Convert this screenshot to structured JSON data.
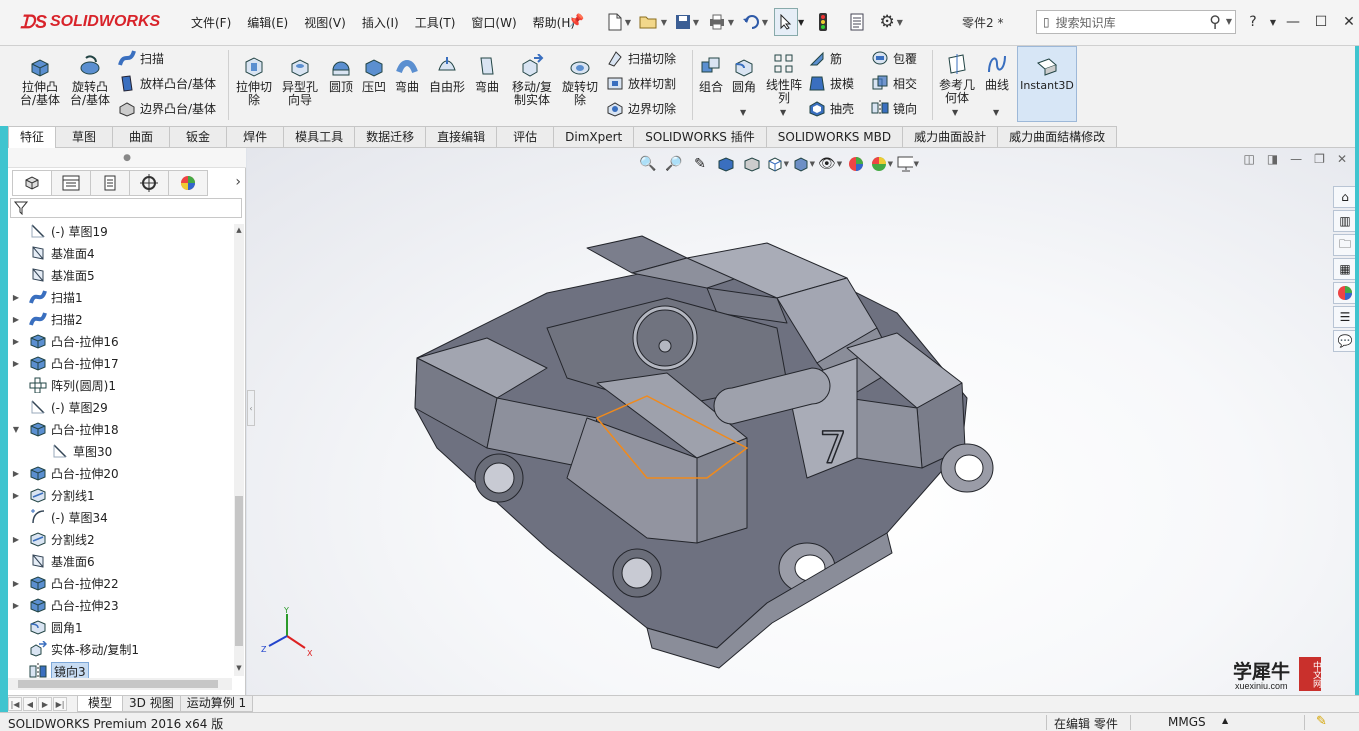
{
  "app": {
    "logo_text": "SOLIDWORKS",
    "document_name": "零件2 *",
    "colors": {
      "brand_red": "#d8232a",
      "accent_blue": "#3a6fbf",
      "selection": "#c7dcf3",
      "model_gray": "#8d9099",
      "frame_cyan": "#3fc4cf"
    }
  },
  "menu": [
    "文件(F)",
    "编辑(E)",
    "视图(V)",
    "插入(I)",
    "工具(T)",
    "窗口(W)",
    "帮助(H)"
  ],
  "search": {
    "placeholder": "搜索知识库"
  },
  "ribbon": {
    "extrude_boss": "拉伸凸\n台/基体",
    "revolve_boss": "旋转凸\n台/基体",
    "sweep": "扫描",
    "loft_boss": "放样凸台/基体",
    "boundary_boss": "边界凸台/基体",
    "extrude_cut": "拉伸切\n除",
    "hole_wizard": "异型孔\n向导",
    "dome": "圆顶",
    "indent": "压凹",
    "flex": "弯曲",
    "freeform": "自由形",
    "deform": "弯曲",
    "move_copy": "移动/复\n制实体",
    "revolve_cut": "旋转切\n除",
    "swept_cut": "扫描切除",
    "lofted_cut": "放样切割",
    "boundary_cut": "边界切除",
    "combine": "组合",
    "fillet": "圆角",
    "linear_pattern": "线性阵\n列",
    "rib": "筋",
    "draft": "拔模",
    "shell": "抽壳",
    "wrap": "包覆",
    "intersect": "相交",
    "mirror": "镜向",
    "ref_geometry": "参考几\n何体",
    "curves": "曲线",
    "instant3d": "Instant3D"
  },
  "tabs": [
    "特征",
    "草图",
    "曲面",
    "钣金",
    "焊件",
    "模具工具",
    "数据迁移",
    "直接编辑",
    "评估",
    "DimXpert",
    "SOLIDWORKS 插件",
    "SOLIDWORKS MBD",
    "威力曲面設計",
    "威力曲面結構修改"
  ],
  "tree": [
    {
      "label": "(-) 草图19",
      "icon": "sketch-icon",
      "expand": ""
    },
    {
      "label": "基准面4",
      "icon": "plane-icon",
      "expand": ""
    },
    {
      "label": "基准面5",
      "icon": "plane-icon",
      "expand": ""
    },
    {
      "label": "扫描1",
      "icon": "sweep-icon",
      "expand": "▶"
    },
    {
      "label": "扫描2",
      "icon": "sweep-icon",
      "expand": "▶"
    },
    {
      "label": "凸台-拉伸16",
      "icon": "extrude-icon",
      "expand": "▶"
    },
    {
      "label": "凸台-拉伸17",
      "icon": "extrude-icon",
      "expand": "▶"
    },
    {
      "label": "阵列(圆周)1",
      "icon": "pattern-icon",
      "expand": ""
    },
    {
      "label": "(-) 草图29",
      "icon": "sketch-icon",
      "expand": ""
    },
    {
      "label": "凸台-拉伸18",
      "icon": "extrude-icon",
      "expand": "▼"
    },
    {
      "label": "草图30",
      "icon": "sketch-icon",
      "expand": "",
      "indent": true
    },
    {
      "label": "凸台-拉伸20",
      "icon": "extrude-icon",
      "expand": "▶"
    },
    {
      "label": "分割线1",
      "icon": "split-icon",
      "expand": "▶"
    },
    {
      "label": "(-) 草图34",
      "icon": "sketch3d-icon",
      "expand": ""
    },
    {
      "label": "分割线2",
      "icon": "split-icon",
      "expand": "▶"
    },
    {
      "label": "基准面6",
      "icon": "plane-icon",
      "expand": ""
    },
    {
      "label": "凸台-拉伸22",
      "icon": "extrude-icon",
      "expand": "▶"
    },
    {
      "label": "凸台-拉伸23",
      "icon": "extrude-icon",
      "expand": "▶"
    },
    {
      "label": "圆角1",
      "icon": "fillet-icon",
      "expand": ""
    },
    {
      "label": "实体-移动/复制1",
      "icon": "move-icon",
      "expand": ""
    },
    {
      "label": "镜向3",
      "icon": "mirror-icon",
      "expand": "",
      "selected": true
    }
  ],
  "bottom_tabs": [
    "模型",
    "3D 视图",
    "运动算例 1"
  ],
  "status": {
    "product": "SOLIDWORKS Premium 2016 x64 版",
    "mode": "在编辑 零件",
    "units": "MMGS"
  },
  "triad": {
    "y": "Y",
    "z": "Z",
    "x": "X"
  },
  "watermark": {
    "main": "学犀牛",
    "sub": "xuexiniu.com",
    "badge": "中文网"
  },
  "viewport": {
    "number_decal": "7"
  }
}
